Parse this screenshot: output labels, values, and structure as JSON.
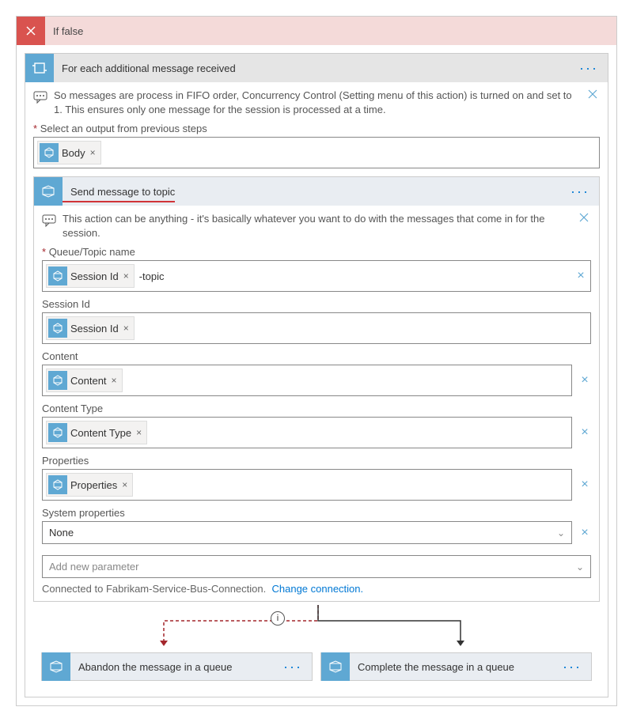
{
  "iffalse": {
    "title": "If false"
  },
  "foreach": {
    "title": "For each additional message received",
    "hint": "So messages are process in FIFO order, Concurrency Control (Setting menu of this action) is turned on and set to 1. This ensures only one message for the session is processed at a time.",
    "select_output_label": "Select an output from previous steps",
    "body_token": "Body"
  },
  "send": {
    "title": "Send message to topic",
    "hint": "This action can be anything - it's basically whatever you want to do with the messages that come in for the session.",
    "fields": {
      "queue_label": "Queue/Topic name",
      "queue_token": "Session Id",
      "queue_suffix": "-topic",
      "session_label": "Session Id",
      "session_token": "Session Id",
      "content_label": "Content",
      "content_token": "Content",
      "ctype_label": "Content Type",
      "ctype_token": "Content Type",
      "props_label": "Properties",
      "props_token": "Properties",
      "sysprops_label": "System properties",
      "sysprops_value": "None",
      "add_param": "Add new parameter"
    },
    "connected": "Connected to Fabrikam-Service-Bus-Connection.",
    "change": "Change connection."
  },
  "branches": {
    "abandon": "Abandon the message in a queue",
    "complete": "Complete the message in a queue"
  }
}
